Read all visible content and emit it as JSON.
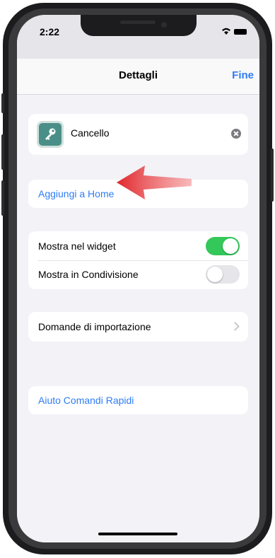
{
  "status_bar": {
    "time": "2:22"
  },
  "navbar": {
    "title": "Dettagli",
    "done": "Fine"
  },
  "shortcut": {
    "name": "Cancello",
    "icon": "key-icon",
    "icon_color": "#4a8f87"
  },
  "add_to_home": {
    "label": "Aggiungi a Home"
  },
  "options": {
    "widget": {
      "label": "Mostra nel widget",
      "on": true
    },
    "share": {
      "label": "Mostra in Condivisione",
      "on": false
    }
  },
  "import_questions": {
    "label": "Domande di importazione"
  },
  "help": {
    "label": "Aiuto Comandi Rapidi"
  },
  "colors": {
    "accent": "#2f7cf6",
    "toggle_on": "#34c759",
    "arrow": "#e0262b"
  }
}
